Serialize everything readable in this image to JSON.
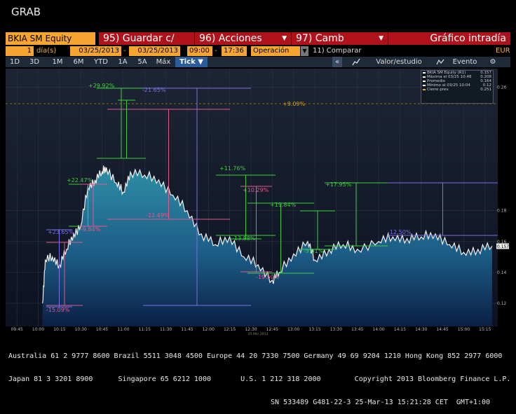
{
  "window_title": "GRAB",
  "command_bar": {
    "ticker": "BKIA SM Equity",
    "buttons": [
      {
        "key": "95)",
        "label": "Guardar c/"
      },
      {
        "key": "96)",
        "label": "Acciones"
      },
      {
        "key": "97)",
        "label": "Camb"
      },
      {
        "key": "",
        "label": "Gráfico intradía"
      }
    ]
  },
  "params": {
    "period_count": "1",
    "period_unit": "día(s)",
    "start_date": "03/25/2013",
    "date_sep": "-",
    "end_date": "03/25/2013",
    "start_time": "09:00",
    "time_sep": "-",
    "end_time": "17:36",
    "mode": "Operación",
    "compare": "11) Comparar",
    "currency": "EUR"
  },
  "period_tabs": [
    "1D",
    "3D",
    "1M",
    "6M",
    "YTD",
    "1A",
    "5A",
    "Máx",
    "Tick"
  ],
  "selected_tab": "Tick",
  "toolbar": {
    "collapse": "«",
    "study": "Valor/estudio",
    "event": "Evento"
  },
  "legend": {
    "rows": [
      {
        "label": "BKIA SM Equity (R1)",
        "value": "0.157",
        "color": "#ffffff"
      },
      {
        "label": "Máxima el 03/25 10:48",
        "value": "0.208",
        "color": "#ffffff"
      },
      {
        "label": "Promedio",
        "value": "0.164",
        "color": "#ffffff"
      },
      {
        "label": "Mínimo al 03/25 10:04",
        "value": "0.12",
        "color": "#ffffff"
      },
      {
        "label": "Cierre prev.",
        "value": "0.251",
        "color": "#f7a531"
      }
    ]
  },
  "annotations": [
    "+29.92%",
    "-21.65%",
    "+9.09%",
    "-22.49%",
    "+11.76%",
    "+10.29%",
    "+19.84%",
    "+17.95%",
    "-12.50%",
    "-13.88%",
    "-9.01%",
    "-19.50%",
    "+22.47%",
    "-9.84%",
    "+23.65%",
    "-15.09%"
  ],
  "chart_data": {
    "type": "area",
    "title": "",
    "xlabel": "",
    "ylabel": "",
    "x_ticks": [
      "09:45",
      "10:00",
      "10:15",
      "10:30",
      "10:45",
      "11:00",
      "11:15",
      "11:30",
      "11:45",
      "12:00",
      "12:15",
      "12:30",
      "12:45",
      "13:00",
      "13:15",
      "13:30",
      "13:45",
      "14:00",
      "14:15",
      "14:30",
      "14:45",
      "15:00",
      "15:15"
    ],
    "x_note": "25 Mar 2013",
    "y_ticks": [
      "0.26",
      "0.18",
      "0.16",
      "0.14",
      "0.12"
    ],
    "last_price_label": "0.157",
    "series": [
      {
        "name": "BKIA SM Equity",
        "x": [
          "10:03",
          "10:05",
          "10:10",
          "10:15",
          "10:20",
          "10:25",
          "10:30",
          "10:35",
          "10:40",
          "10:45",
          "10:48",
          "10:55",
          "11:00",
          "11:05",
          "11:15",
          "11:25",
          "11:35",
          "11:45",
          "11:55",
          "12:05",
          "12:15",
          "12:25",
          "12:35",
          "12:45",
          "12:50",
          "13:00",
          "13:10",
          "13:15",
          "13:25",
          "13:35",
          "13:45",
          "14:00",
          "14:10",
          "14:20",
          "14:30",
          "14:40",
          "14:50",
          "15:00",
          "15:10",
          "15:20"
        ],
        "values": [
          0.12,
          0.148,
          0.15,
          0.145,
          0.155,
          0.165,
          0.17,
          0.195,
          0.2,
          0.205,
          0.208,
          0.198,
          0.192,
          0.205,
          0.203,
          0.2,
          0.19,
          0.18,
          0.165,
          0.158,
          0.163,
          0.15,
          0.145,
          0.135,
          0.14,
          0.152,
          0.16,
          0.148,
          0.155,
          0.158,
          0.155,
          0.16,
          0.163,
          0.162,
          0.163,
          0.165,
          0.158,
          0.153,
          0.155,
          0.157
        ]
      }
    ]
  },
  "footer": {
    "line1": "Australia 61 2 9777 8600 Brazil 5511 3048 4500 Europe 44 20 7330 7500 Germany 49 69 9204 1210 Hong Kong 852 2977 6000",
    "line2": "Japan 81 3 3201 8900      Singapore 65 6212 1000       U.S. 1 212 318 2000        Copyright 2013 Bloomberg Finance L.P.",
    "line3": "SN 533489 G481-22-3 25-Mar-13 15:21:28 CET  GMT+1:00"
  }
}
